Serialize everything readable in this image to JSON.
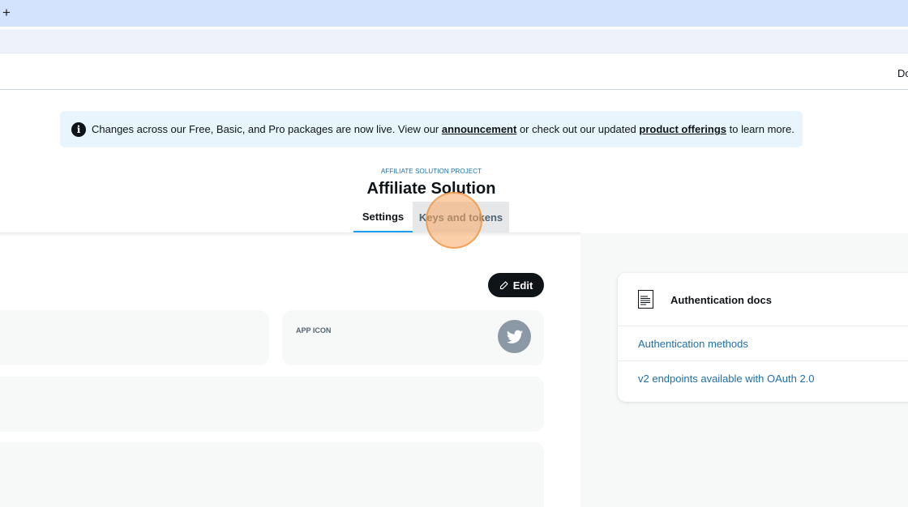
{
  "browser": {
    "new_tab_label": "+"
  },
  "header": {
    "link_label": "Do"
  },
  "banner": {
    "text_before": "Changes across our Free, Basic, and Pro packages are now live. View our ",
    "link_announcement": "announcement",
    "text_middle": " or check out our updated ",
    "link_offerings": "product offerings",
    "text_after": " to learn more."
  },
  "project": {
    "eyebrow": "AFFILIATE SOLUTION PROJECT",
    "title": "Affiliate Solution"
  },
  "tabs": [
    {
      "label": "Settings",
      "active": true
    },
    {
      "label": "Keys and tokens",
      "active": false
    }
  ],
  "toolbar": {
    "edit_label": "Edit"
  },
  "app_icon_card": {
    "label": "APP ICON"
  },
  "docs": {
    "title": "Authentication docs",
    "links": [
      {
        "label": "Authentication methods"
      },
      {
        "label": "v2 endpoints available with OAuth 2.0"
      }
    ]
  },
  "colors": {
    "accent": "#1d9bf0",
    "link": "#1d6fa8",
    "banner_bg": "#e8f5fd",
    "dark": "#0f1419",
    "click_marker": "#f7a860"
  },
  "icons": {
    "banner": "info-icon",
    "edit": "pencil-icon",
    "app": "twitter-bird-icon",
    "docs": "document-icon"
  }
}
